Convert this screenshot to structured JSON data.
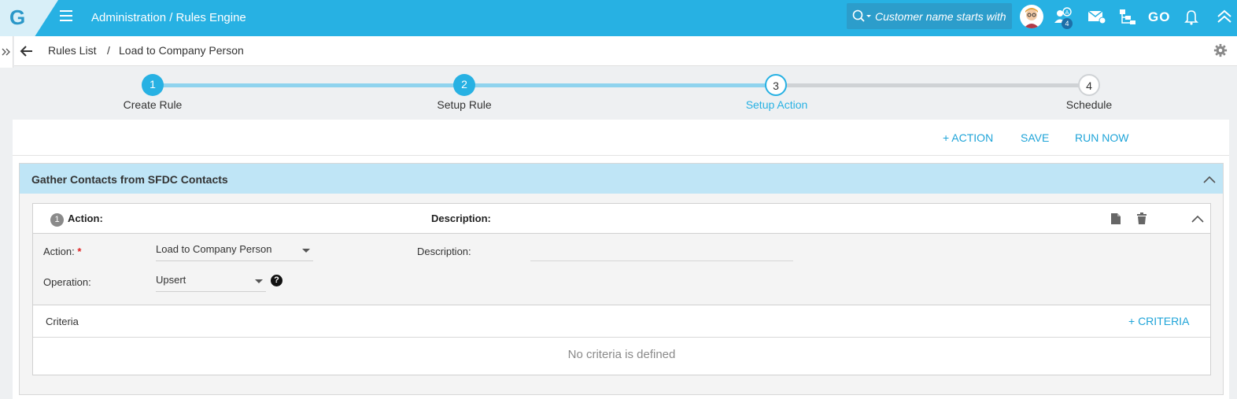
{
  "header": {
    "logo": "G",
    "title": "Administration / Rules Engine",
    "search_placeholder": "Customer name starts with",
    "notification_badge": "4",
    "go_label": "GO",
    "colors": {
      "bar": "#27b1e3",
      "accent": "#1fa4d8"
    }
  },
  "breadcrumb": {
    "items": [
      "Rules List",
      "Load to Company Person"
    ],
    "separator": "/"
  },
  "stepper": {
    "steps": [
      {
        "number": "1",
        "label": "Create Rule",
        "state": "done"
      },
      {
        "number": "2",
        "label": "Setup Rule",
        "state": "done"
      },
      {
        "number": "3",
        "label": "Setup Action",
        "state": "active"
      },
      {
        "number": "4",
        "label": "Schedule",
        "state": "pending"
      }
    ]
  },
  "actions": {
    "add_action": "+ ACTION",
    "save": "SAVE",
    "run_now": "RUN NOW"
  },
  "group": {
    "title": "Gather Contacts from SFDC Contacts"
  },
  "action_card": {
    "number": "1",
    "action_header": "Action:",
    "description_header": "Description:",
    "fields": {
      "action_label": "Action:",
      "required_mark": "*",
      "action_value": "Load to Company Person",
      "operation_label": "Operation:",
      "operation_value": "Upsert",
      "help": "?",
      "description_label": "Description:"
    },
    "criteria": {
      "label": "Criteria",
      "add_button": "+ CRITERIA",
      "empty_text": "No criteria is defined"
    }
  }
}
